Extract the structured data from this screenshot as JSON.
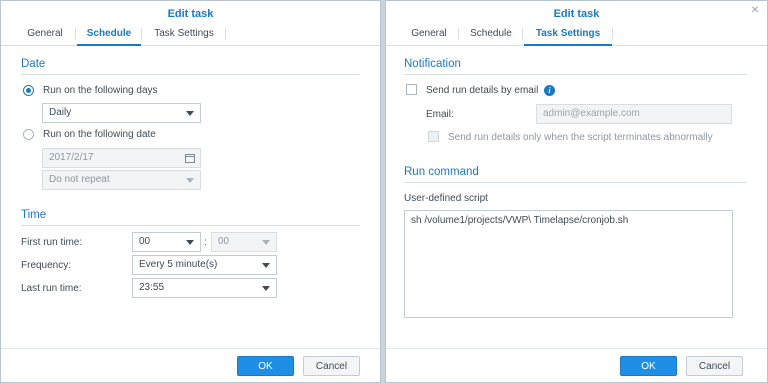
{
  "left_dialog": {
    "title": "Edit task",
    "tabs": [
      "General",
      "Schedule",
      "Task Settings"
    ],
    "active_tab": "Schedule",
    "date_section": {
      "title": "Date",
      "option_days_label": "Run on the following days",
      "days_value": "Daily",
      "option_date_label": "Run on the following date",
      "date_value": "2017/2/17",
      "repeat_value": "Do not repeat"
    },
    "time_section": {
      "title": "Time",
      "first_run_label": "First run time:",
      "first_run_hour": "00",
      "first_run_minute": "00",
      "time_separator": ":",
      "frequency_label": "Frequency:",
      "frequency_value": "Every 5 minute(s)",
      "last_run_label": "Last run time:",
      "last_run_value": "23:55"
    },
    "ok_label": "OK",
    "cancel_label": "Cancel"
  },
  "right_dialog": {
    "title": "Edit task",
    "tabs": [
      "General",
      "Schedule",
      "Task Settings"
    ],
    "active_tab": "Task Settings",
    "notification": {
      "title": "Notification",
      "send_email_label": "Send run details by email",
      "email_label": "Email:",
      "email_placeholder": "admin@example.com",
      "abnormal_label": "Send run details only when the script terminates abnormally"
    },
    "run_command": {
      "title": "Run command",
      "script_label": "User-defined script",
      "script_value": "sh /volume1/projects/VWP\\ Timelapse/cronjob.sh"
    },
    "ok_label": "OK",
    "cancel_label": "Cancel"
  },
  "colors": {
    "accent": "#1b79c4",
    "primary_button": "#1f8fe6",
    "background": "#c9d3dc"
  }
}
